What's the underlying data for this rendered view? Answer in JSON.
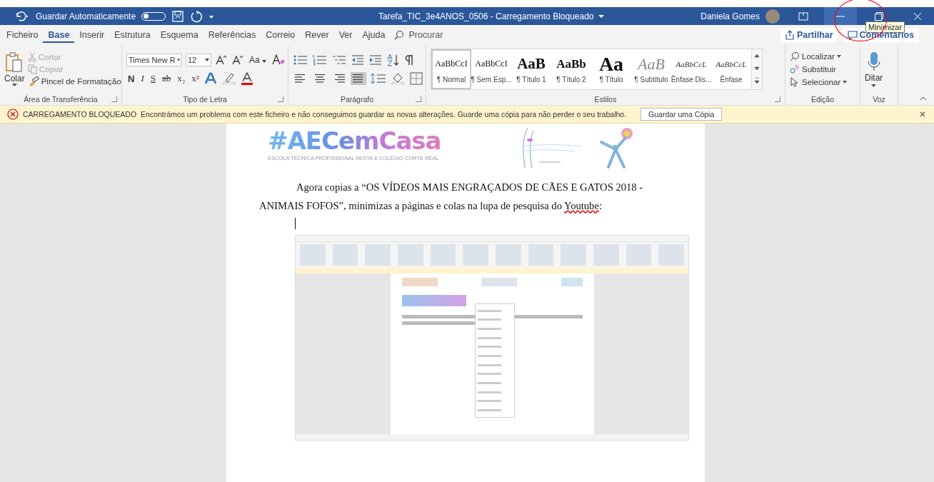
{
  "title_bar": {
    "autosave_label": "Guardar Automaticamente",
    "autosave_on": false,
    "title": "Tarefa_TIC_3e4ANOS_0506  -  Carregamento Bloqueado",
    "user": "Daniela Gomes",
    "tooltip": "Minimizar"
  },
  "menu_tabs": [
    {
      "label": "Ficheiro",
      "selected": false
    },
    {
      "label": "Base",
      "selected": true
    },
    {
      "label": "Inserir",
      "selected": false
    },
    {
      "label": "Estrutura",
      "selected": false
    },
    {
      "label": "Esquema",
      "selected": false
    },
    {
      "label": "Referências",
      "selected": false
    },
    {
      "label": "Correio",
      "selected": false
    },
    {
      "label": "Rever",
      "selected": false
    },
    {
      "label": "Ver",
      "selected": false
    },
    {
      "label": "Ajuda",
      "selected": false
    }
  ],
  "search": {
    "placeholder": "Procurar"
  },
  "share_button": "Partilhar",
  "comments_button": "Comentários",
  "clipboard": {
    "label": "Área de Transferência",
    "paste": "Colar",
    "items": [
      {
        "label": "Cortar",
        "disabled": true,
        "kind": "cut"
      },
      {
        "label": "Copiar",
        "disabled": true,
        "kind": "copy"
      },
      {
        "label": "Pincel de Formatação",
        "disabled": false,
        "kind": "brush"
      }
    ]
  },
  "font": {
    "label": "Tipo de Letra",
    "name": "Times New R",
    "size": "12",
    "case_button": "Aa",
    "format_buttons": [
      {
        "text": "N",
        "kind": "bold"
      },
      {
        "text": "I",
        "kind": "italic"
      },
      {
        "text": "S",
        "kind": "underline"
      },
      {
        "text": "ab",
        "kind": "strike"
      },
      {
        "text": "x₂",
        "kind": "sub"
      },
      {
        "text": "x²",
        "kind": "sup"
      }
    ]
  },
  "paragraph": {
    "label": "Parágrafo",
    "alignments": [
      {
        "kind": "left",
        "selected": false
      },
      {
        "kind": "center",
        "selected": false
      },
      {
        "kind": "right",
        "selected": false
      },
      {
        "kind": "justify",
        "selected": true
      }
    ]
  },
  "styles": {
    "label": "Estilos",
    "items": [
      {
        "preview": "AaBbCcI",
        "name": "¶ Normal",
        "kind": "normal",
        "selected": true
      },
      {
        "preview": "AaBbCcI",
        "name": "¶ Sem Esp...",
        "kind": "normal",
        "selected": false
      },
      {
        "preview": "AaB",
        "name": "¶ Título 1",
        "kind": "heading1",
        "selected": false
      },
      {
        "preview": "AaBb",
        "name": "¶ Título 2",
        "kind": "heading2",
        "selected": false
      },
      {
        "preview": "Aa",
        "name": "¶ Título",
        "kind": "title",
        "selected": false
      },
      {
        "preview": "AaB",
        "name": "¶ Subtítulo",
        "kind": "subtitle",
        "selected": false
      },
      {
        "preview": "AaBbCcL",
        "name": "Ênfase Dis...",
        "kind": "emphasis",
        "selected": false
      },
      {
        "preview": "AaBbCcL",
        "name": "Ênfase",
        "kind": "emphasis",
        "selected": false
      }
    ]
  },
  "editing": {
    "label": "Edição",
    "items": [
      {
        "label": "Localizar",
        "kind": "find"
      },
      {
        "label": "Substituir",
        "kind": "replace"
      },
      {
        "label": "Selecionar",
        "kind": "select"
      }
    ]
  },
  "voice": {
    "label": "Voz",
    "dictate": "Ditar"
  },
  "message_bar": {
    "title": "CARREGAMENTO BLOQUEADO",
    "text": "Encontrámos um problema com este ficheiro e não conseguimos guardar as novas alterações. Guarde uma cópia para não perder o seu trabalho.",
    "button": "Guardar uma Cópia"
  },
  "document": {
    "logo_text": "#AECemCasa",
    "logo_subtitle": "ESCOLA TÉCNICA PROFISSIONAL MOITA & COLÉGIO CORTE REAL",
    "paragraph": {
      "before": "Agora copias a “OS VÍDEOS MAIS ENGRAÇADOS DE CÃES E GATOS 2018 - ANIMAIS FOFOS”, minimizas a páginas e colas na lupa de pesquisa do ",
      "misspelled": "Youtube",
      "after": ":"
    }
  }
}
